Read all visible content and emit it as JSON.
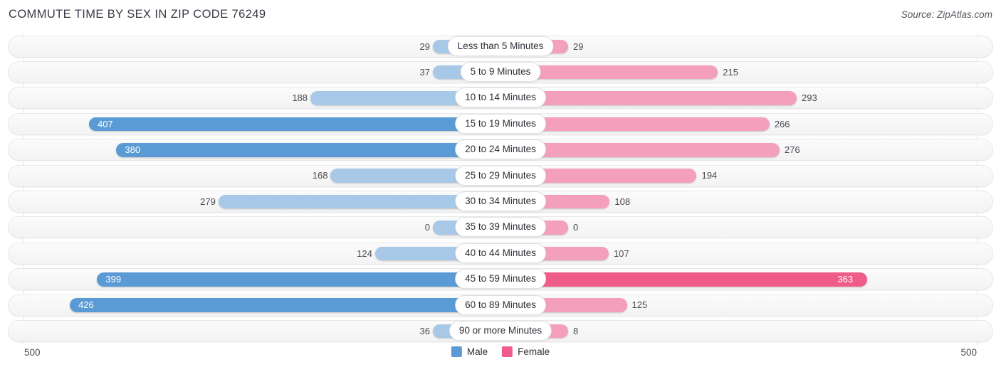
{
  "header": {
    "title": "COMMUTE TIME BY SEX IN ZIP CODE 76249",
    "source": "Source: ZipAtlas.com"
  },
  "legend": {
    "items": [
      {
        "label": "Male",
        "color": "#5b9bd5"
      },
      {
        "label": "Female",
        "color": "#ef5c8a"
      }
    ]
  },
  "axis": {
    "max_left": "500",
    "max_right": "500"
  },
  "colors": {
    "male_strong": "#5b9bd5",
    "male_light": "#a8c8e8",
    "female_strong": "#ef5c8a",
    "female_light": "#f4a0bd",
    "track": "#f5f5f5",
    "gridline": "#e2e2e6"
  },
  "chart_data": {
    "type": "bar",
    "title": "COMMUTE TIME BY SEX IN ZIP CODE 76249",
    "subtitle": "",
    "orientation": "horizontal-diverging",
    "xlabel": "",
    "ylabel": "",
    "xlim": [
      -500,
      500
    ],
    "grid": true,
    "legend_position": "bottom-center",
    "categories": [
      "Less than 5 Minutes",
      "5 to 9 Minutes",
      "10 to 14 Minutes",
      "15 to 19 Minutes",
      "20 to 24 Minutes",
      "25 to 29 Minutes",
      "30 to 34 Minutes",
      "35 to 39 Minutes",
      "40 to 44 Minutes",
      "45 to 59 Minutes",
      "60 to 89 Minutes",
      "90 or more Minutes"
    ],
    "series": [
      {
        "name": "Male",
        "color": "#5b9bd5",
        "values": [
          29,
          37,
          188,
          407,
          380,
          168,
          279,
          0,
          124,
          399,
          426,
          36
        ]
      },
      {
        "name": "Female",
        "color": "#ef5c8a",
        "values": [
          29,
          215,
          293,
          266,
          276,
          194,
          108,
          0,
          107,
          363,
          125,
          8
        ]
      }
    ],
    "rows": [
      {
        "category": "Less than 5 Minutes",
        "male": 29,
        "male_label": "29",
        "female": 29,
        "female_label": "29",
        "male_inside": false,
        "female_inside": false
      },
      {
        "category": "5 to 9 Minutes",
        "male": 37,
        "male_label": "37",
        "female": 215,
        "female_label": "215",
        "male_inside": false,
        "female_inside": false
      },
      {
        "category": "10 to 14 Minutes",
        "male": 188,
        "male_label": "188",
        "female": 293,
        "female_label": "293",
        "male_inside": false,
        "female_inside": false
      },
      {
        "category": "15 to 19 Minutes",
        "male": 407,
        "male_label": "407",
        "female": 266,
        "female_label": "266",
        "male_inside": true,
        "female_inside": false
      },
      {
        "category": "20 to 24 Minutes",
        "male": 380,
        "male_label": "380",
        "female": 276,
        "female_label": "276",
        "male_inside": true,
        "female_inside": false
      },
      {
        "category": "25 to 29 Minutes",
        "male": 168,
        "male_label": "168",
        "female": 194,
        "female_label": "194",
        "male_inside": false,
        "female_inside": false
      },
      {
        "category": "30 to 34 Minutes",
        "male": 279,
        "male_label": "279",
        "female": 108,
        "female_label": "108",
        "male_inside": false,
        "female_inside": false
      },
      {
        "category": "35 to 39 Minutes",
        "male": 0,
        "male_label": "0",
        "female": 0,
        "female_label": "0",
        "male_inside": false,
        "female_inside": false
      },
      {
        "category": "40 to 44 Minutes",
        "male": 124,
        "male_label": "124",
        "female": 107,
        "female_label": "107",
        "male_inside": false,
        "female_inside": false
      },
      {
        "category": "45 to 59 Minutes",
        "male": 399,
        "male_label": "399",
        "female": 363,
        "female_label": "363",
        "male_inside": true,
        "female_inside": true
      },
      {
        "category": "60 to 89 Minutes",
        "male": 426,
        "male_label": "426",
        "female": 125,
        "female_label": "125",
        "male_inside": true,
        "female_inside": false
      },
      {
        "category": "90 or more Minutes",
        "male": 36,
        "male_label": "36",
        "female": 8,
        "female_label": "8",
        "male_inside": false,
        "female_inside": false
      }
    ]
  }
}
